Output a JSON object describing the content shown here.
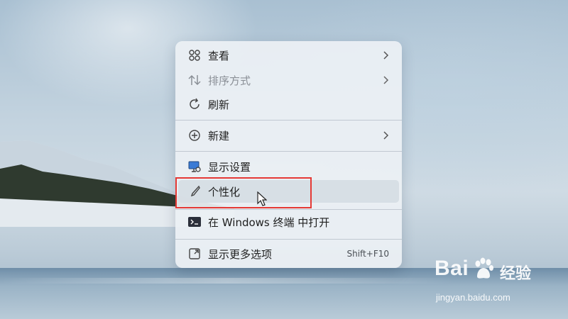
{
  "context_menu": {
    "items": [
      {
        "label": "查看",
        "icon": "view-grid-icon",
        "submenu": true,
        "disabled": false
      },
      {
        "label": "排序方式",
        "icon": "sort-arrows-icon",
        "submenu": true,
        "disabled": true
      },
      {
        "label": "刷新",
        "icon": "refresh-icon",
        "submenu": false,
        "disabled": false
      },
      {
        "label": "新建",
        "icon": "new-plus-icon",
        "submenu": true,
        "disabled": false
      },
      {
        "label": "显示设置",
        "icon": "display-settings-icon",
        "submenu": false,
        "disabled": false
      },
      {
        "label": "个性化",
        "icon": "personalize-brush-icon",
        "submenu": false,
        "disabled": false,
        "hovered": true
      },
      {
        "label": "在 Windows 终端 中打开",
        "icon": "terminal-icon",
        "submenu": false,
        "disabled": false
      },
      {
        "label": "显示更多选项",
        "icon": "more-options-icon",
        "submenu": false,
        "disabled": false,
        "shortcut": "Shift+F10"
      }
    ]
  },
  "watermark": {
    "brand": "Bai  经验",
    "brand_prefix": "Bai",
    "brand_suffix": "经验",
    "url": "jingyan.baidu.com"
  },
  "colors": {
    "highlight_box": "#e53935",
    "menu_background": "#ecf0f4"
  }
}
